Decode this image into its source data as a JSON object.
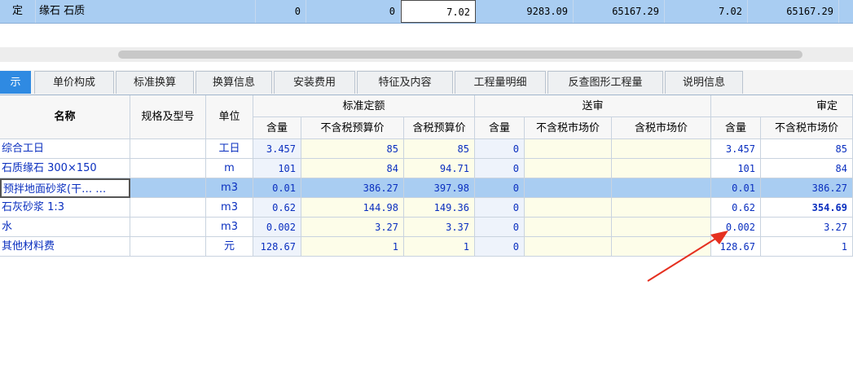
{
  "top_row": {
    "code": "定",
    "name": "缘石 石质",
    "v1": "0",
    "v2": "0",
    "v3": "7.02",
    "v4": "9283.09",
    "v5": "65167.29",
    "v6": "7.02",
    "v7": "65167.29"
  },
  "tabs": [
    {
      "label": "示",
      "active": true
    },
    {
      "label": "单价构成"
    },
    {
      "label": "标准换算"
    },
    {
      "label": "换算信息"
    },
    {
      "label": "安装费用"
    },
    {
      "label": "特征及内容"
    },
    {
      "label": "工程量明细"
    },
    {
      "label": "反查图形工程量"
    },
    {
      "label": "说明信息"
    }
  ],
  "headers": {
    "name": "名称",
    "spec": "规格及型号",
    "unit": "单位",
    "group_standard": "标准定额",
    "group_submit": "送审",
    "group_review": "审定",
    "qty": "含量",
    "excl_budget": "不含税预算价",
    "incl_budget": "含税预算价",
    "excl_market": "不含税市场价",
    "incl_market": "含税市场价"
  },
  "rows": [
    {
      "name": "综合工日",
      "spec": "",
      "unit": "工日",
      "s_qty": "3.457",
      "s_excl": "85",
      "s_incl": "85",
      "sub_qty": "0",
      "sub_excl": "",
      "sub_incl": "",
      "r_qty": "3.457",
      "r_excl": "85"
    },
    {
      "name": "石质缘石 300×150",
      "spec": "",
      "unit": "m",
      "s_qty": "101",
      "s_excl": "84",
      "s_incl": "94.71",
      "sub_qty": "0",
      "sub_excl": "",
      "sub_incl": "",
      "r_qty": "101",
      "r_excl": "84"
    },
    {
      "name": "预拌地面砂浆(干… …",
      "spec": "",
      "unit": "m3",
      "s_qty": "0.01",
      "s_excl": "386.27",
      "s_incl": "397.98",
      "sub_qty": "0",
      "sub_excl": "",
      "sub_incl": "",
      "r_qty": "0.01",
      "r_excl": "386.27"
    },
    {
      "name": "石灰砂浆 1:3",
      "spec": "",
      "unit": "m3",
      "s_qty": "0.62",
      "s_excl": "144.98",
      "s_incl": "149.36",
      "sub_qty": "0",
      "sub_excl": "",
      "sub_incl": "",
      "r_qty": "0.62",
      "r_excl": "354.69"
    },
    {
      "name": "水",
      "spec": "",
      "unit": "m3",
      "s_qty": "0.002",
      "s_excl": "3.27",
      "s_incl": "3.37",
      "sub_qty": "0",
      "sub_excl": "",
      "sub_incl": "",
      "r_qty": "0.002",
      "r_excl": "3.27"
    },
    {
      "name": "其他材料费",
      "spec": "",
      "unit": "元",
      "s_qty": "128.67",
      "s_excl": "1",
      "s_incl": "1",
      "sub_qty": "0",
      "sub_excl": "",
      "sub_incl": "",
      "r_qty": "128.67",
      "r_excl": "1"
    }
  ],
  "colors": {
    "accent": "#2f8ae2",
    "selected_row": "#a9cdf2",
    "annotation_arrow": "#e53020",
    "cell_text": "#0a2fbf"
  }
}
